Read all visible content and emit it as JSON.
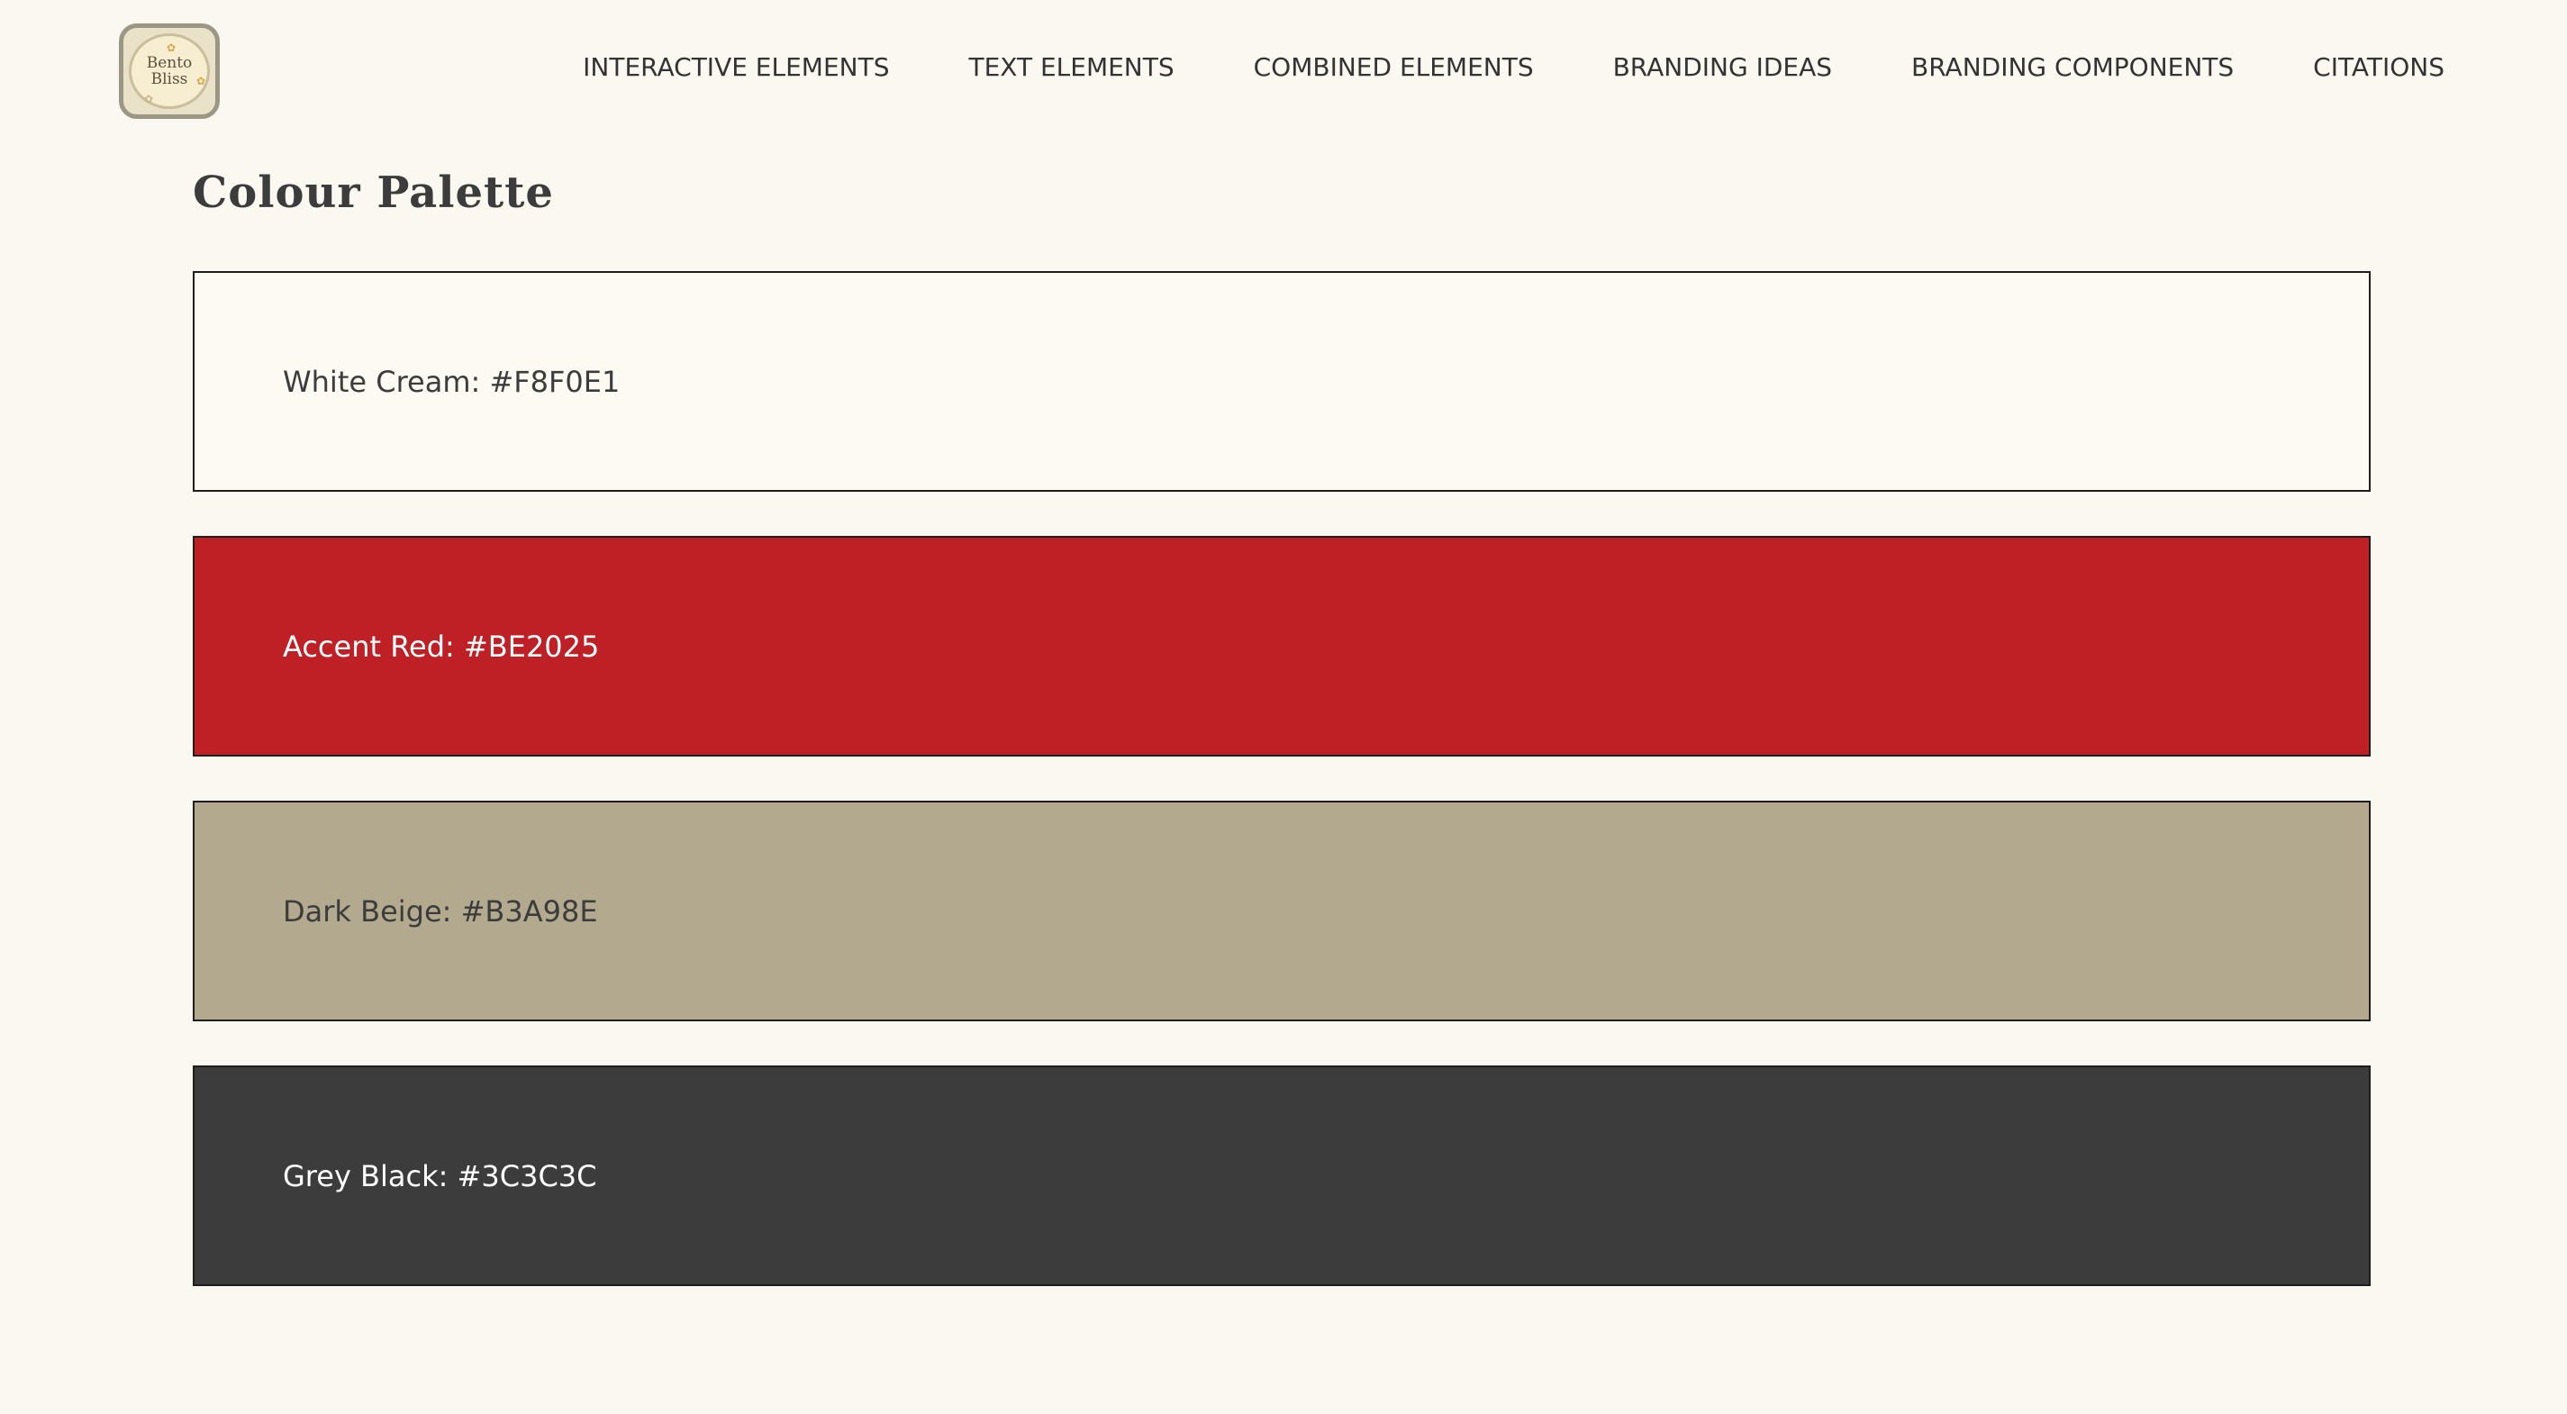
{
  "header": {
    "logo": {
      "line1": "Bento",
      "line2": "Bliss"
    },
    "nav": [
      {
        "label": "INTERACTIVE ELEMENTS"
      },
      {
        "label": "TEXT ELEMENTS"
      },
      {
        "label": "COMBINED ELEMENTS"
      },
      {
        "label": "BRANDING IDEAS"
      },
      {
        "label": "BRANDING COMPONENTS"
      },
      {
        "label": "CITATIONS"
      }
    ]
  },
  "main": {
    "title": "Colour Palette",
    "swatches": [
      {
        "label": "White Cream: #F8F0E1",
        "color": "#FDFAF3",
        "text_color": "#3C3C3C"
      },
      {
        "label": "Accent Red: #BE2025",
        "color": "#BE2025",
        "text_color": "#FFFFFF"
      },
      {
        "label": "Dark Beige: #B3A98E",
        "color": "#B3A98E",
        "text_color": "#3C3C3C"
      },
      {
        "label": "Grey Black: #3C3C3C",
        "color": "#3C3C3C",
        "text_color": "#FFFFFF"
      }
    ]
  },
  "icons": {
    "logo": "bento-bliss-logo-icon",
    "flower": "flower-icon"
  }
}
